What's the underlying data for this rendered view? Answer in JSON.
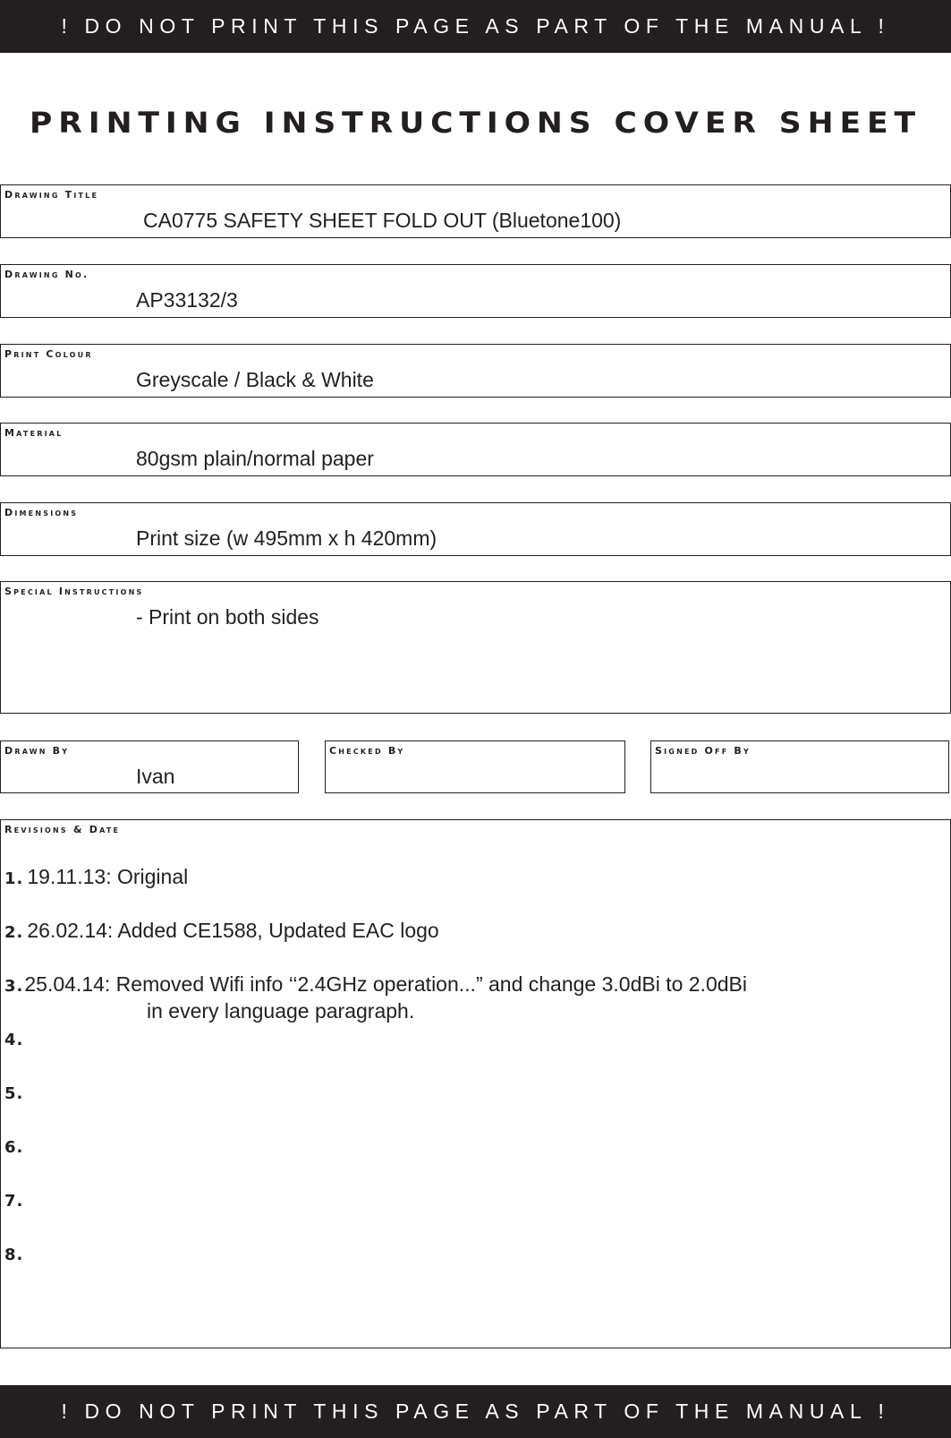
{
  "banner": {
    "top_text": "! DO NOT PRINT THIS PAGE AS PART OF THE MANUAL !",
    "bottom_text": "! DO NOT PRINT THIS PAGE AS PART OF THE MANUAL !"
  },
  "header": {
    "title": "PRINTING INSTRUCTIONS COVER SHEET"
  },
  "fields": {
    "drawing_title": {
      "label": "Drawing Title",
      "value": "CA0775  SAFETY SHEET FOLD OUT (Bluetone100)"
    },
    "drawing_no": {
      "label": "Drawing No.",
      "value": "AP33132/3"
    },
    "print_colour": {
      "label": "Print Colour",
      "value": "Greyscale / Black & White"
    },
    "material": {
      "label": "Material",
      "value": "80gsm plain/normal paper"
    },
    "dimensions": {
      "label": "Dimensions",
      "value": "Print size (w 495mm x h 420mm)"
    },
    "special_instructions": {
      "label": "Special Instructions",
      "value": "- Print on both sides"
    },
    "drawn_by": {
      "label": "Drawn By",
      "value": "Ivan"
    },
    "checked_by": {
      "label": "Checked By",
      "value": ""
    },
    "signed_off_by": {
      "label": "Signed Off By",
      "value": ""
    }
  },
  "revisions": {
    "label": "Revisions & Date",
    "items": [
      {
        "num": "1.",
        "text": "19.11.13:  Original",
        "continuation": ""
      },
      {
        "num": "2.",
        "text": "26.02.14:  Added CE1588, Updated EAC logo",
        "continuation": ""
      },
      {
        "num": "3.",
        "text": "25.04.14:  Removed Wifi info ‘‘2.4GHz operation...” and change 3.0dBi to 2.0dBi",
        "continuation": "in every language paragraph."
      },
      {
        "num": "4.",
        "text": "",
        "continuation": ""
      },
      {
        "num": "5.",
        "text": "",
        "continuation": ""
      },
      {
        "num": "6.",
        "text": "",
        "continuation": ""
      },
      {
        "num": "7.",
        "text": "",
        "continuation": ""
      },
      {
        "num": "8.",
        "text": "",
        "continuation": ""
      }
    ]
  },
  "colors": {
    "banner_bg": "#231f20",
    "banner_text": "#ffffff",
    "ink": "#231f20"
  }
}
